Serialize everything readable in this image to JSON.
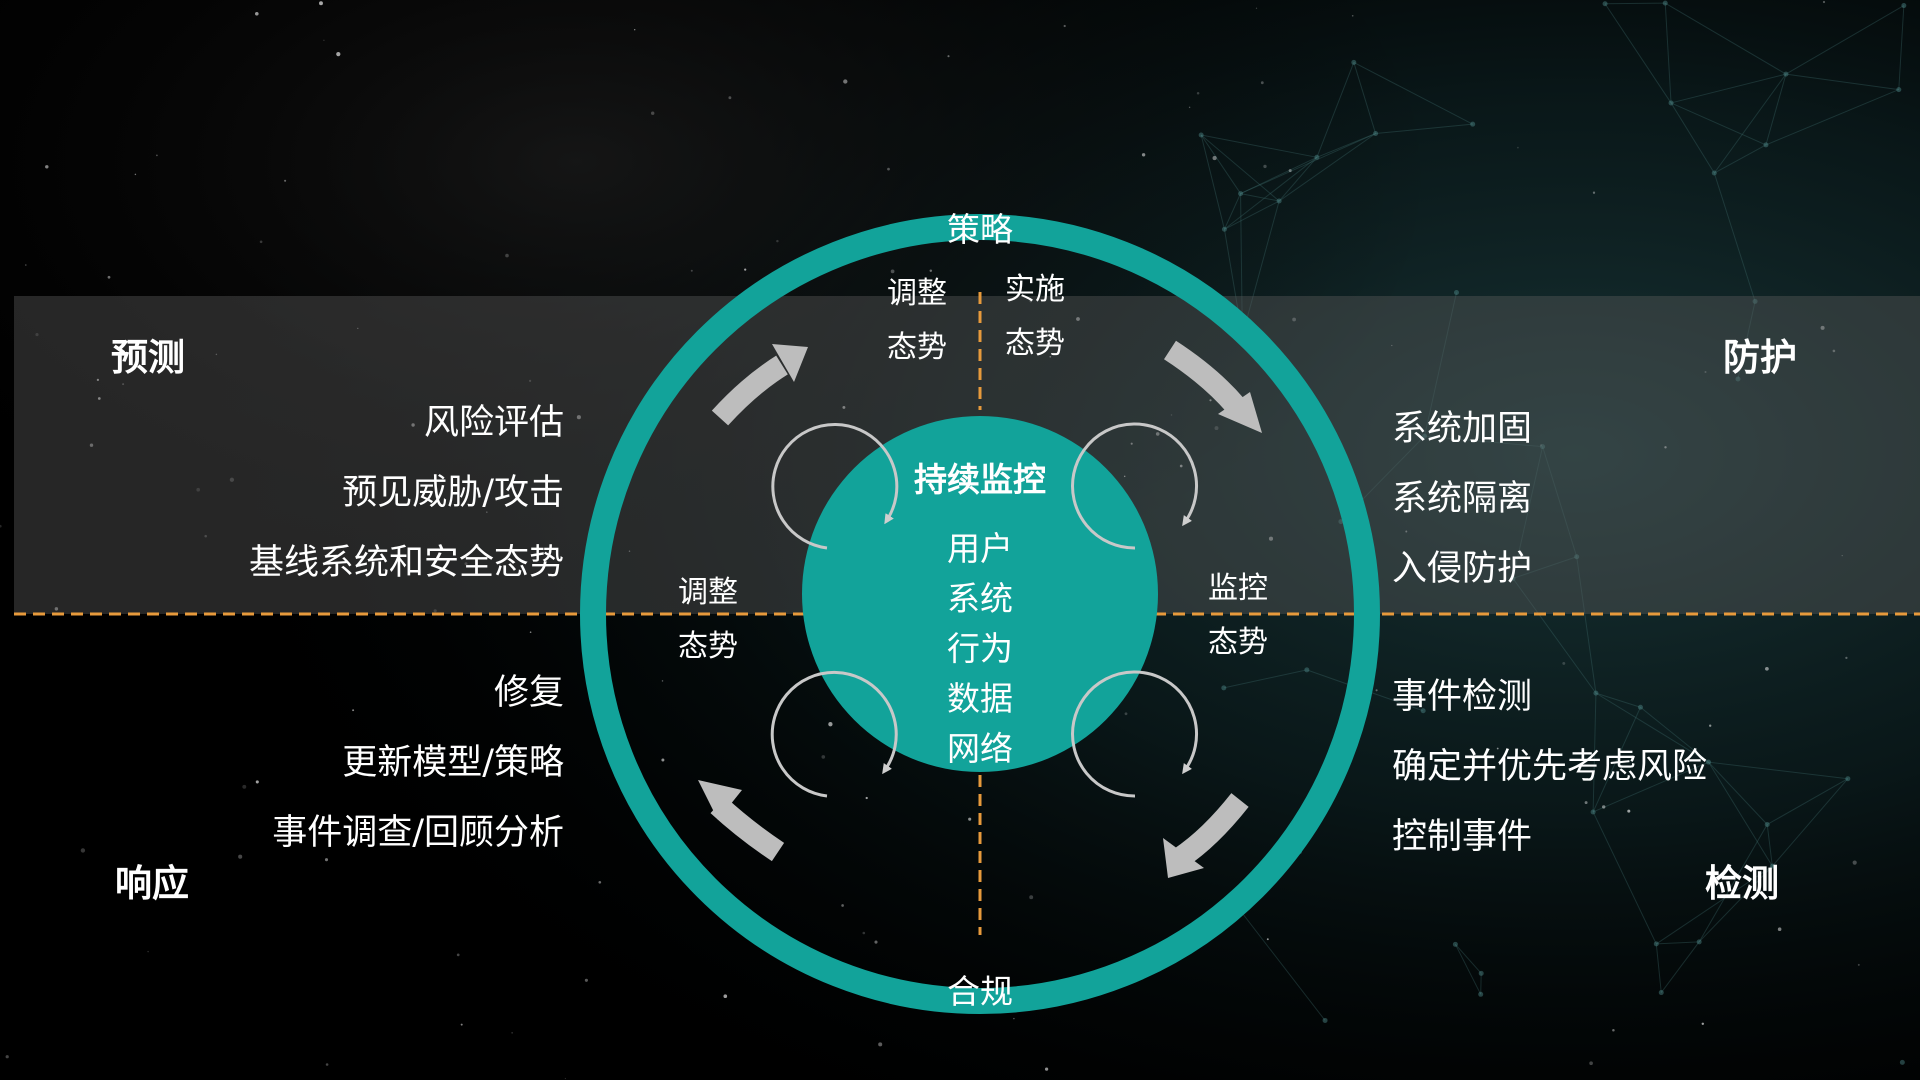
{
  "quadrants": {
    "predict": {
      "title": "预测",
      "items": [
        "风险评估",
        "预见威胁/攻击",
        "基线系统和安全态势"
      ]
    },
    "protect": {
      "title": "防护",
      "items": [
        "系统加固",
        "系统隔离",
        "入侵防护"
      ]
    },
    "respond": {
      "title": "响应",
      "items": [
        "修复",
        "更新模型/策略",
        "事件调查/回顾分析"
      ]
    },
    "detect": {
      "title": "检测",
      "items": [
        "事件检测",
        "确定并优先考虑风险",
        "控制事件"
      ]
    }
  },
  "ring": {
    "top_label": "策略",
    "bottom_label": "合规"
  },
  "inner_labels": {
    "top_left": [
      "调整",
      "态势"
    ],
    "top_right": [
      "实施",
      "态势"
    ],
    "mid_left": [
      "调整",
      "态势"
    ],
    "mid_right": [
      "监控",
      "态势"
    ]
  },
  "center": {
    "title": "持续监控",
    "items": [
      "用户",
      "系统",
      "行为",
      "数据",
      "网络"
    ]
  },
  "colors": {
    "background": "#000000",
    "band": "#4a4a4a",
    "ring": "#12a39a",
    "dashed_line": "#e79a3c",
    "large_arrow": "#bdbdbd",
    "small_arrow": "#c8c8c8"
  },
  "icons": [
    "large-curved-arrow-icon",
    "small-circular-arrow-icon"
  ]
}
